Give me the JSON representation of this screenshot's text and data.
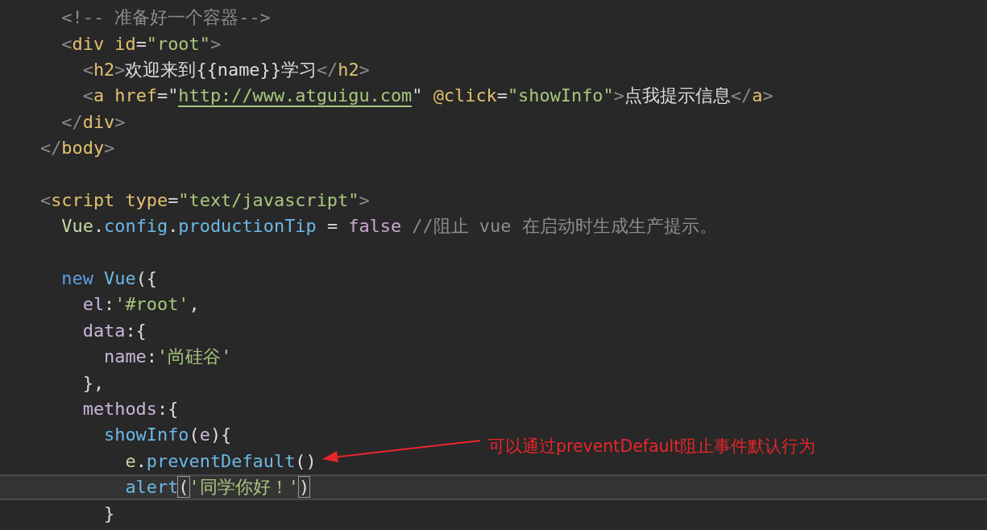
{
  "editor": {
    "lines": [
      {
        "highlighted": false,
        "tokens": [
          {
            "text": "  <!-- 准备好一个容器-->",
            "kind": "comment"
          }
        ]
      },
      {
        "highlighted": false,
        "tokens": [
          {
            "text": "  <",
            "kind": "punct"
          },
          {
            "text": "div",
            "kind": "tag"
          },
          {
            "text": " id",
            "kind": "attr"
          },
          {
            "text": "=",
            "kind": "plain"
          },
          {
            "text": "\"root\"",
            "kind": "string"
          },
          {
            "text": ">",
            "kind": "punct"
          }
        ]
      },
      {
        "highlighted": false,
        "tokens": [
          {
            "text": "    <",
            "kind": "punct"
          },
          {
            "text": "h2",
            "kind": "tag"
          },
          {
            "text": ">",
            "kind": "punct"
          },
          {
            "text": "欢迎来到{{name}}学习",
            "kind": "plain"
          },
          {
            "text": "</",
            "kind": "punct"
          },
          {
            "text": "h2",
            "kind": "tag"
          },
          {
            "text": ">",
            "kind": "punct"
          }
        ]
      },
      {
        "highlighted": false,
        "tokens": [
          {
            "text": "    <",
            "kind": "punct"
          },
          {
            "text": "a",
            "kind": "tag"
          },
          {
            "text": " href",
            "kind": "attr"
          },
          {
            "text": "=\"",
            "kind": "plain"
          },
          {
            "text": "http://www.atguigu.com",
            "kind": "link"
          },
          {
            "text": "\" ",
            "kind": "plain"
          },
          {
            "text": "@click",
            "kind": "attr"
          },
          {
            "text": "=",
            "kind": "plain"
          },
          {
            "text": "\"showInfo\"",
            "kind": "string"
          },
          {
            "text": ">",
            "kind": "punct"
          },
          {
            "text": "点我提示信息",
            "kind": "plain"
          },
          {
            "text": "</",
            "kind": "punct"
          },
          {
            "text": "a",
            "kind": "tag"
          },
          {
            "text": ">",
            "kind": "punct"
          }
        ]
      },
      {
        "highlighted": false,
        "tokens": [
          {
            "text": "  </",
            "kind": "punct"
          },
          {
            "text": "div",
            "kind": "tag"
          },
          {
            "text": ">",
            "kind": "punct"
          }
        ]
      },
      {
        "highlighted": false,
        "tokens": [
          {
            "text": "</",
            "kind": "punct"
          },
          {
            "text": "body",
            "kind": "tag"
          },
          {
            "text": ">",
            "kind": "punct"
          }
        ]
      },
      {
        "highlighted": false
      },
      {
        "highlighted": false,
        "tokens": [
          {
            "text": "<",
            "kind": "punct"
          },
          {
            "text": "script",
            "kind": "tag"
          },
          {
            "text": " type",
            "kind": "attr"
          },
          {
            "text": "=",
            "kind": "plain"
          },
          {
            "text": "\"text/javascript\"",
            "kind": "string"
          },
          {
            "text": ">",
            "kind": "punct"
          }
        ]
      },
      {
        "highlighted": false,
        "tokens": [
          {
            "text": "  Vue",
            "kind": "class"
          },
          {
            "text": ".",
            "kind": "plain"
          },
          {
            "text": "config",
            "kind": "property"
          },
          {
            "text": ".",
            "kind": "plain"
          },
          {
            "text": "productionTip",
            "kind": "property"
          },
          {
            "text": " = ",
            "kind": "plain"
          },
          {
            "text": "false",
            "kind": "constant"
          },
          {
            "text": " //阻止 vue 在启动时生成生产提示。",
            "kind": "comment"
          }
        ]
      },
      {
        "highlighted": false
      },
      {
        "highlighted": false,
        "tokens": [
          {
            "text": "  new",
            "kind": "keyword"
          },
          {
            "text": " Vue",
            "kind": "property"
          },
          {
            "text": "({",
            "kind": "plain"
          }
        ]
      },
      {
        "highlighted": false,
        "tokens": [
          {
            "text": "    el",
            "kind": "key"
          },
          {
            "text": ":",
            "kind": "plain"
          },
          {
            "text": "'#root'",
            "kind": "string"
          },
          {
            "text": ",",
            "kind": "plain"
          }
        ]
      },
      {
        "highlighted": false,
        "tokens": [
          {
            "text": "    data",
            "kind": "key"
          },
          {
            "text": ":{",
            "kind": "plain"
          }
        ]
      },
      {
        "highlighted": false,
        "tokens": [
          {
            "text": "      name",
            "kind": "key"
          },
          {
            "text": ":",
            "kind": "plain"
          },
          {
            "text": "'尚硅谷'",
            "kind": "string"
          }
        ]
      },
      {
        "highlighted": false,
        "tokens": [
          {
            "text": "    },",
            "kind": "plain"
          }
        ]
      },
      {
        "highlighted": false,
        "tokens": [
          {
            "text": "    methods",
            "kind": "key"
          },
          {
            "text": ":{",
            "kind": "plain"
          }
        ]
      },
      {
        "highlighted": false,
        "tokens": [
          {
            "text": "      showInfo",
            "kind": "property"
          },
          {
            "text": "(",
            "kind": "plain"
          },
          {
            "text": "e",
            "kind": "key"
          },
          {
            "text": "){",
            "kind": "plain"
          }
        ]
      },
      {
        "highlighted": false,
        "tokens": [
          {
            "text": "        e",
            "kind": "class"
          },
          {
            "text": ".",
            "kind": "plain"
          },
          {
            "text": "preventDefault",
            "kind": "property"
          },
          {
            "text": "()",
            "kind": "plain"
          }
        ]
      },
      {
        "highlighted": true,
        "tokens": [
          {
            "text": "        alert",
            "kind": "property"
          },
          {
            "text": "(",
            "kind": "bracket"
          },
          {
            "text": "'同学你好！'",
            "kind": "string"
          },
          {
            "text": ")",
            "kind": "bracket"
          }
        ]
      },
      {
        "highlighted": false,
        "tokens": [
          {
            "text": "      }",
            "kind": "plain"
          }
        ]
      }
    ]
  },
  "annotation": {
    "text": "可以通过preventDefault阻止事件默认行为"
  }
}
